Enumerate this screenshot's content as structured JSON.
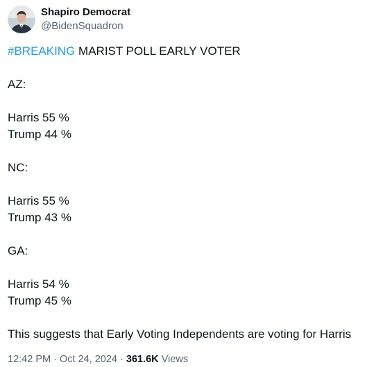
{
  "author": {
    "display_name": "Shapiro Democrat",
    "handle": "@BidenSquadron"
  },
  "tweet": {
    "hashtag": "#BREAKING",
    "headline_rest": " MARIST POLL EARLY VOTER",
    "states": [
      {
        "label": "AZ:",
        "results": [
          "Harris 55 %",
          "Trump 44 %"
        ]
      },
      {
        "label": "NC:",
        "results": [
          "Harris 55 %",
          "Trump 43 %"
        ]
      },
      {
        "label": "GA:",
        "results": [
          "Harris 54 %",
          "Trump 45 %"
        ]
      }
    ],
    "conclusion": "This suggests that Early Voting Independents are voting for Harris"
  },
  "meta": {
    "time": "12:42 PM",
    "separator": " · ",
    "date": "Oct 24, 2024",
    "views_count": "361.6K",
    "views_label": " Views"
  },
  "colors": {
    "text": "#0f1419",
    "secondary": "#536471",
    "link": "#1d9bf0"
  }
}
